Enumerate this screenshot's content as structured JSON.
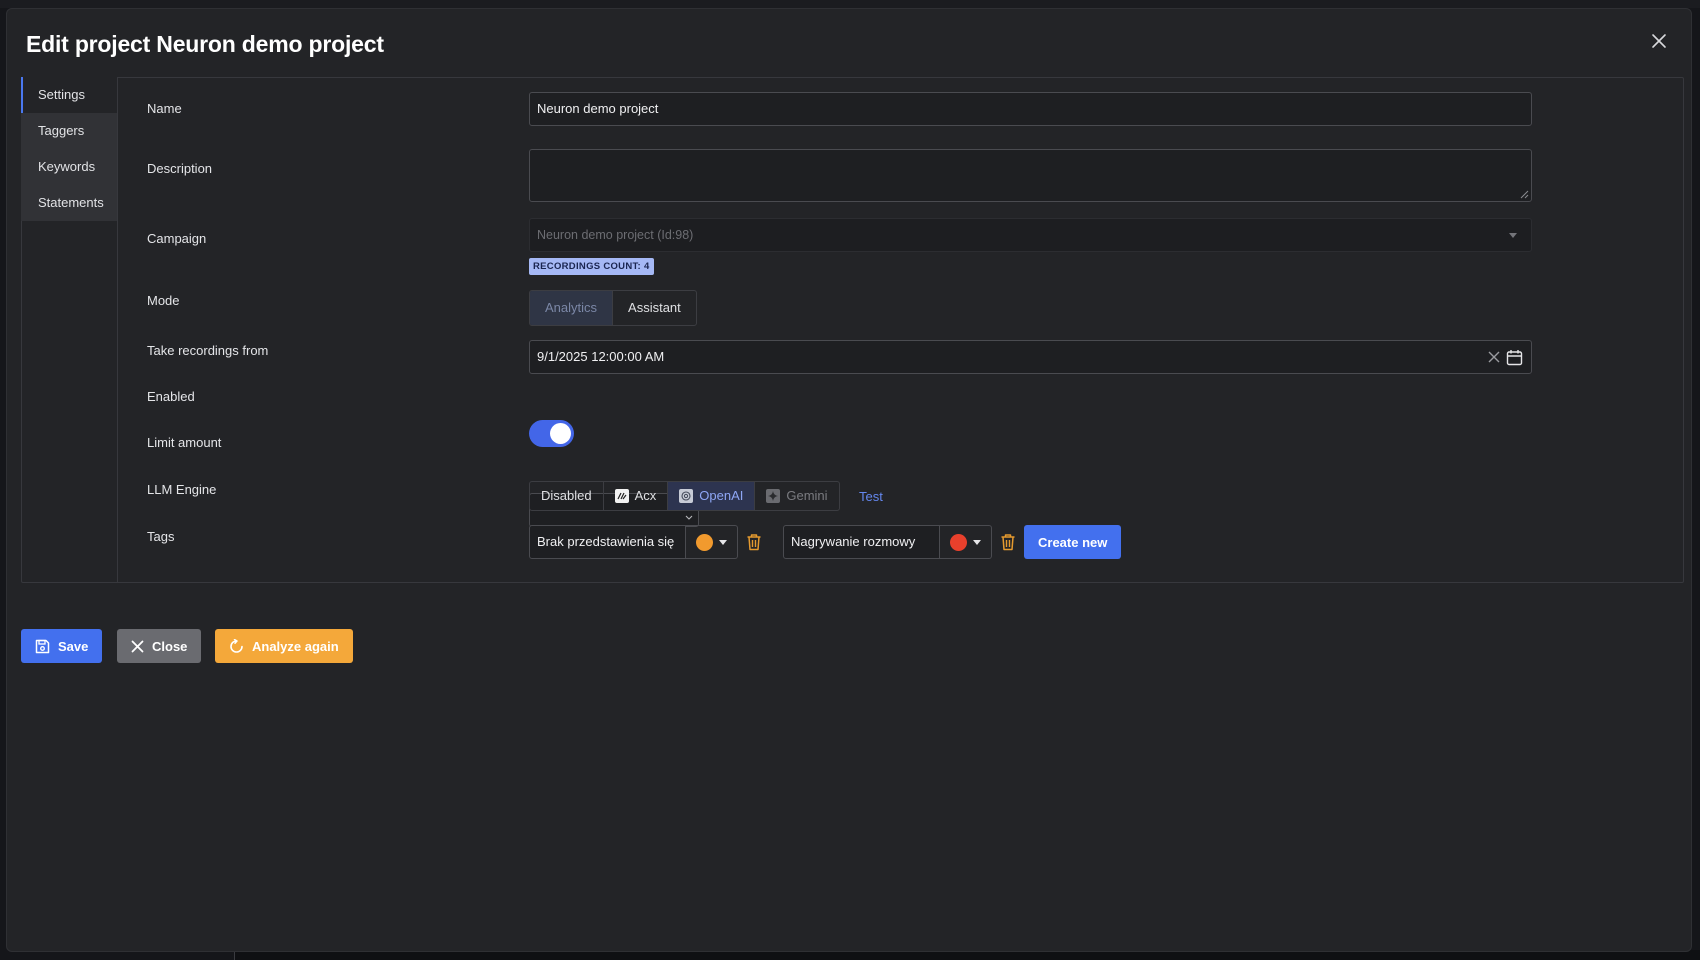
{
  "dialog": {
    "title": "Edit project Neuron demo project"
  },
  "tabs": [
    {
      "label": "Settings",
      "active": true
    },
    {
      "label": "Taggers",
      "active": false
    },
    {
      "label": "Keywords",
      "active": false
    },
    {
      "label": "Statements",
      "active": false
    }
  ],
  "form": {
    "name": {
      "label": "Name",
      "value": "Neuron demo project"
    },
    "description": {
      "label": "Description",
      "value": ""
    },
    "campaign": {
      "label": "Campaign",
      "value": "Neuron demo project (Id:98)",
      "badge": "RECORDINGS COUNT: 4"
    },
    "mode": {
      "label": "Mode",
      "options": [
        "Analytics",
        "Assistant"
      ],
      "selected": "Analytics"
    },
    "take_from": {
      "label": "Take recordings from",
      "value": "9/1/2025 12:00:00 AM"
    },
    "enabled": {
      "label": "Enabled",
      "value": true
    },
    "limit": {
      "label": "Limit amount",
      "value": ""
    },
    "llm": {
      "label": "LLM Engine",
      "options": [
        "Disabled",
        "Acx",
        "OpenAI",
        "Gemini"
      ],
      "selected": "OpenAI",
      "test_label": "Test"
    },
    "tags": {
      "label": "Tags",
      "items": [
        {
          "name": "Brak przedstawienia się",
          "color": "#f19a2e"
        },
        {
          "name": "Nagrywanie rozmowy",
          "color": "#e8402c"
        }
      ],
      "create_label": "Create new"
    }
  },
  "footer": {
    "save_label": "Save",
    "close_label": "Close",
    "analyze_label": "Analyze again"
  },
  "colors": {
    "accent": "#4370ee",
    "warning": "#f4a83a",
    "neutral": "#6a6b70",
    "trash": "#e59a2f"
  }
}
